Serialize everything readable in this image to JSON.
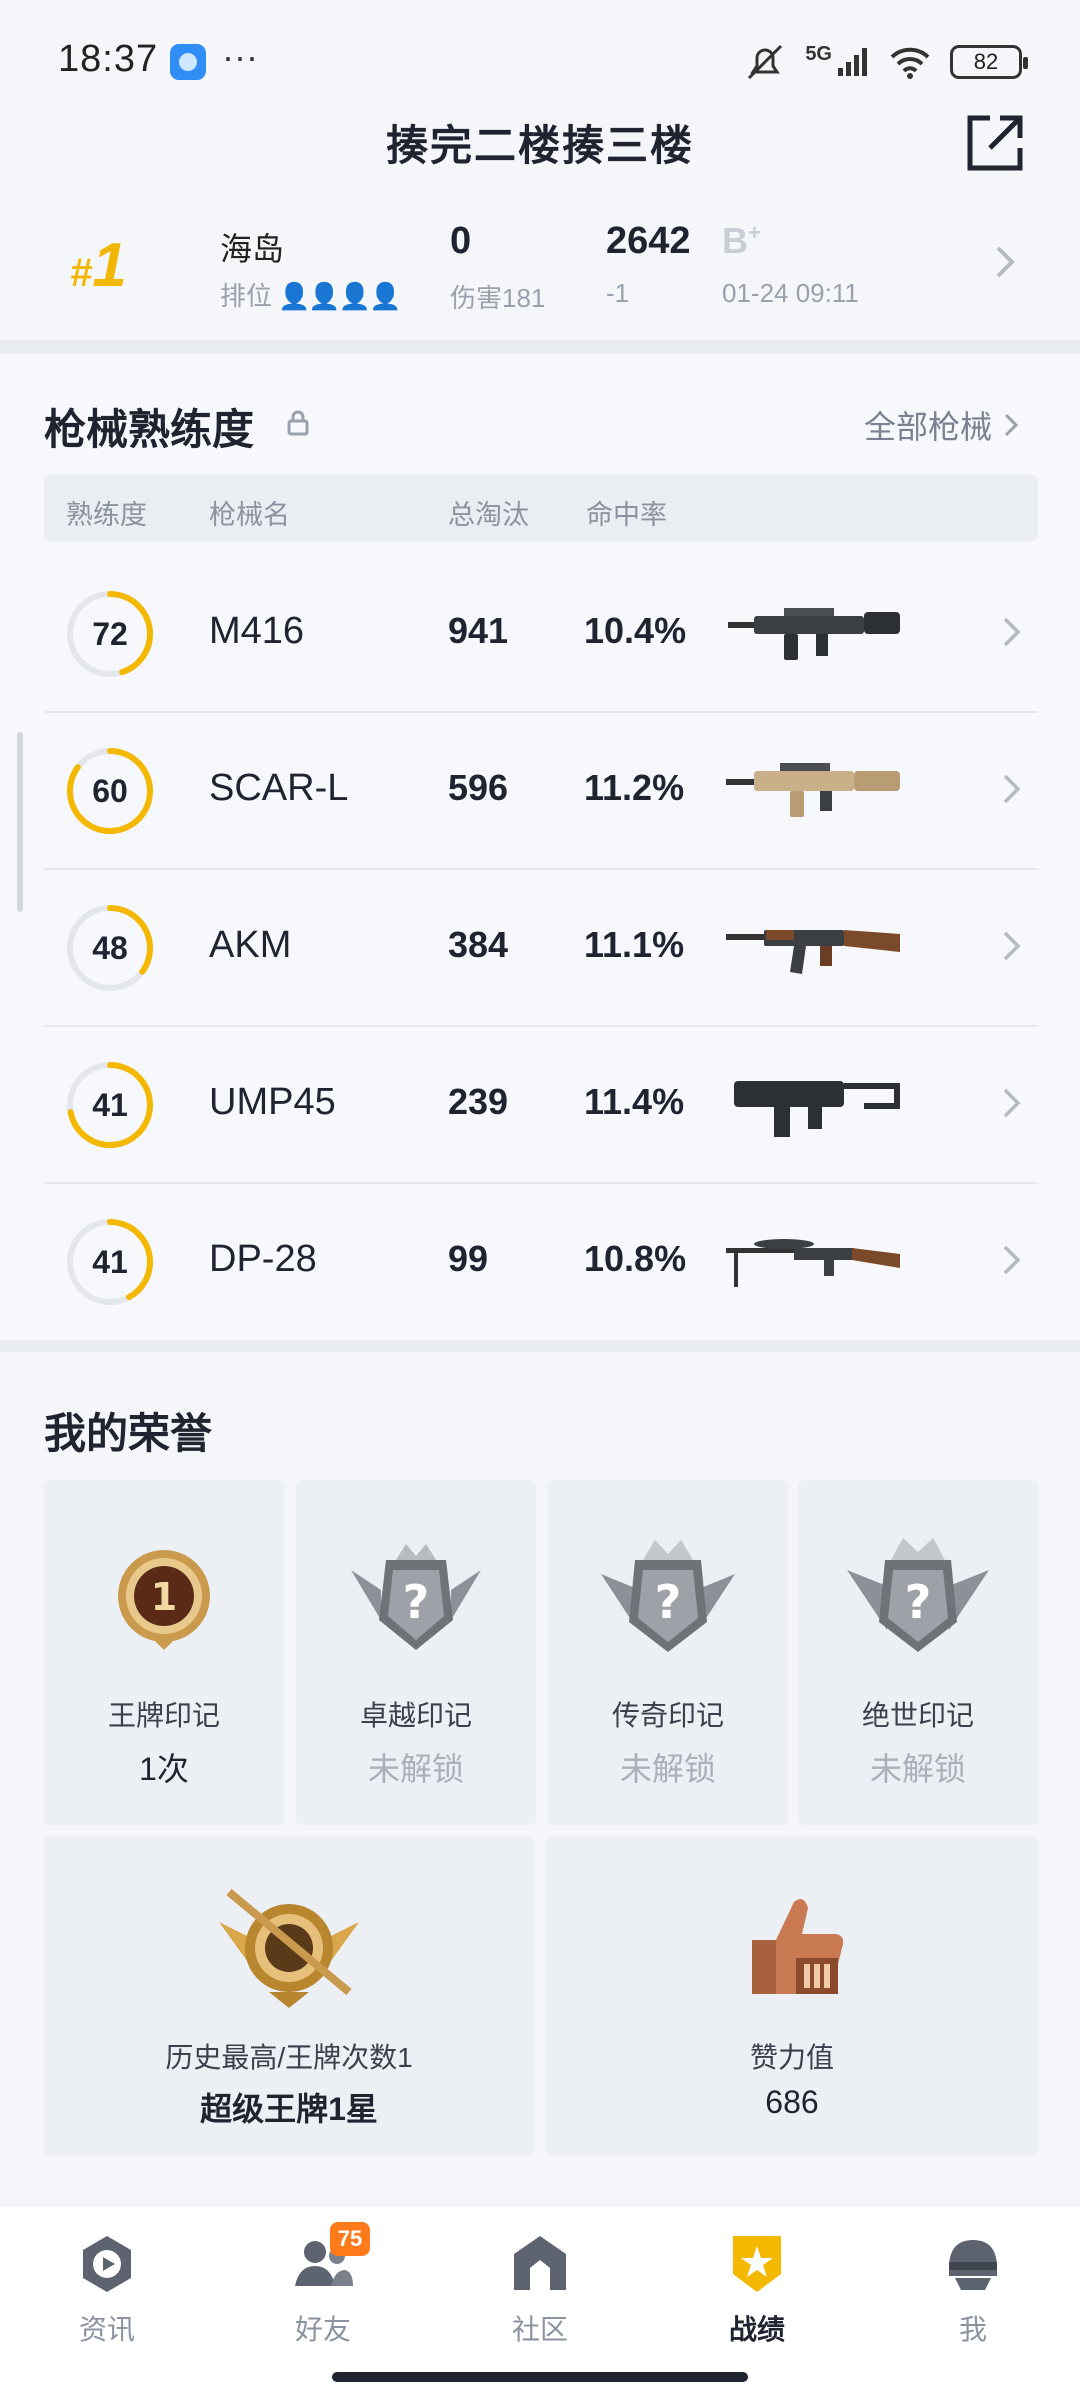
{
  "status_bar": {
    "time": "18:37",
    "more": "···",
    "network": "5G",
    "battery": "82"
  },
  "header": {
    "title": "揍完二楼揍三楼",
    "share_icon": "share-external-icon"
  },
  "recent_match": {
    "rank_hash": "#",
    "rank": "1",
    "map": "海岛",
    "mode": "排位",
    "damage_value": "0",
    "damage_label": "伤害181",
    "score_value": "2642",
    "score_change": "-1",
    "grade": "B",
    "grade_suffix": "+",
    "time": "01-24 09:11"
  },
  "weapons": {
    "title": "枪械熟练度",
    "all_link": "全部枪械",
    "columns": {
      "proficiency": "熟练度",
      "name": "枪械名",
      "eliminations": "总淘汰",
      "hit_rate": "命中率"
    },
    "accent_color": "#f5b800",
    "rows": [
      {
        "proficiency": "72",
        "progress": 0.45,
        "name": "M416",
        "eliminations": "941",
        "hit_rate": "10.4%",
        "image": "m416-rifle"
      },
      {
        "proficiency": "60",
        "progress": 0.85,
        "name": "SCAR-L",
        "eliminations": "596",
        "hit_rate": "11.2%",
        "image": "scar-l-rifle"
      },
      {
        "proficiency": "48",
        "progress": 0.35,
        "name": "AKM",
        "eliminations": "384",
        "hit_rate": "11.1%",
        "image": "akm-rifle"
      },
      {
        "proficiency": "41",
        "progress": 0.72,
        "name": "UMP45",
        "eliminations": "239",
        "hit_rate": "11.4%",
        "image": "ump45-smg"
      },
      {
        "proficiency": "41",
        "progress": 0.42,
        "name": "DP-28",
        "eliminations": "99",
        "hit_rate": "10.8%",
        "image": "dp28-lmg"
      }
    ]
  },
  "honors": {
    "title": "我的荣誉",
    "badges": [
      {
        "label": "王牌印记",
        "value": "1次",
        "locked": false,
        "icon": "ace-medal-icon"
      },
      {
        "label": "卓越印记",
        "value": "未解锁",
        "locked": true,
        "icon": "locked-crown-badge-icon"
      },
      {
        "label": "传奇印记",
        "value": "未解锁",
        "locked": true,
        "icon": "locked-crown-badge-icon"
      },
      {
        "label": "绝世印记",
        "value": "未解锁",
        "locked": true,
        "icon": "locked-crown-badge-icon"
      }
    ],
    "highest": {
      "label": "历史最高/王牌次数1",
      "value": "超级王牌1星",
      "icon": "super-ace-emblem-icon"
    },
    "likes": {
      "label": "赞力值",
      "value": "686",
      "icon": "thumbs-up-icon"
    }
  },
  "bottom_nav": {
    "items": [
      {
        "label": "资讯",
        "icon": "news-play-icon"
      },
      {
        "label": "好友",
        "icon": "friends-icon",
        "badge": "75"
      },
      {
        "label": "社区",
        "icon": "community-house-icon"
      },
      {
        "label": "战绩",
        "icon": "record-shield-icon",
        "active": true
      },
      {
        "label": "我",
        "icon": "helmet-profile-icon"
      }
    ]
  }
}
